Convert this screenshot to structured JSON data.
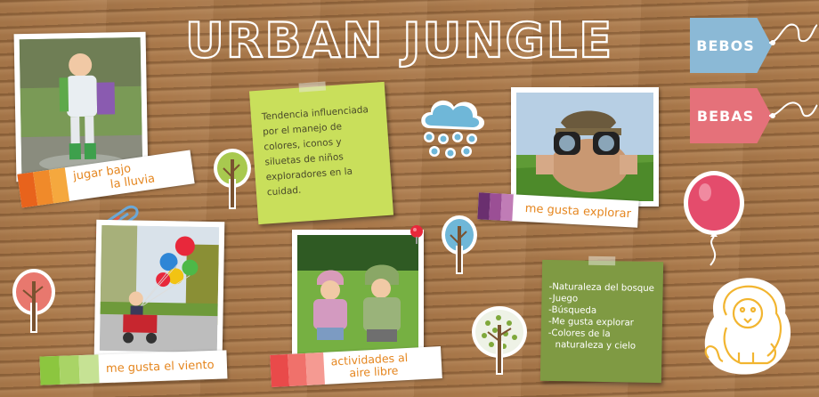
{
  "title": "URBAN JUNGLE",
  "tags": {
    "bebos": "BEBOS",
    "bebas": "BEBAS"
  },
  "labels": {
    "rain": [
      "jugar bajo",
      "la lluvia"
    ],
    "explore": "me gusta explorar",
    "wind": "me gusta el viento",
    "outdoor": [
      "actividades al",
      "aire libre"
    ]
  },
  "note_trend": {
    "lines": [
      "Tendencia influenciada",
      "por el manejo de",
      "colores, iconos y",
      "siluetas de niños",
      "exploradores en la",
      "cuidad."
    ]
  },
  "note_list": {
    "items": [
      "-Naturaleza del bosque",
      "-Juego",
      "-Búsqueda",
      "-Me gusta explorar",
      "-Colores de la",
      "naturaleza y cielo"
    ]
  },
  "colors": {
    "label_text": "#e5861f",
    "rain_swatches": [
      "#e8631c",
      "#f08a2a",
      "#f5a83e"
    ],
    "explore_swatches": [
      "#6a2f6f",
      "#9b4f95",
      "#c07cb6"
    ],
    "wind_swatches": [
      "#8cc63f",
      "#a9d466",
      "#c6e294"
    ],
    "outdoor_swatches": [
      "#e94a4a",
      "#f0716b",
      "#f59a92"
    ],
    "note_trend_bg": "#c9df5b",
    "note_list_bg": "#7f9a43",
    "tag_bebos": "#8bb9d6",
    "tag_bebas": "#e5717a"
  },
  "icons": [
    "cloud-rain-icon",
    "balloon-icon",
    "lion-icon",
    "tree-icon",
    "paperclip-icon",
    "pushpin-icon"
  ]
}
